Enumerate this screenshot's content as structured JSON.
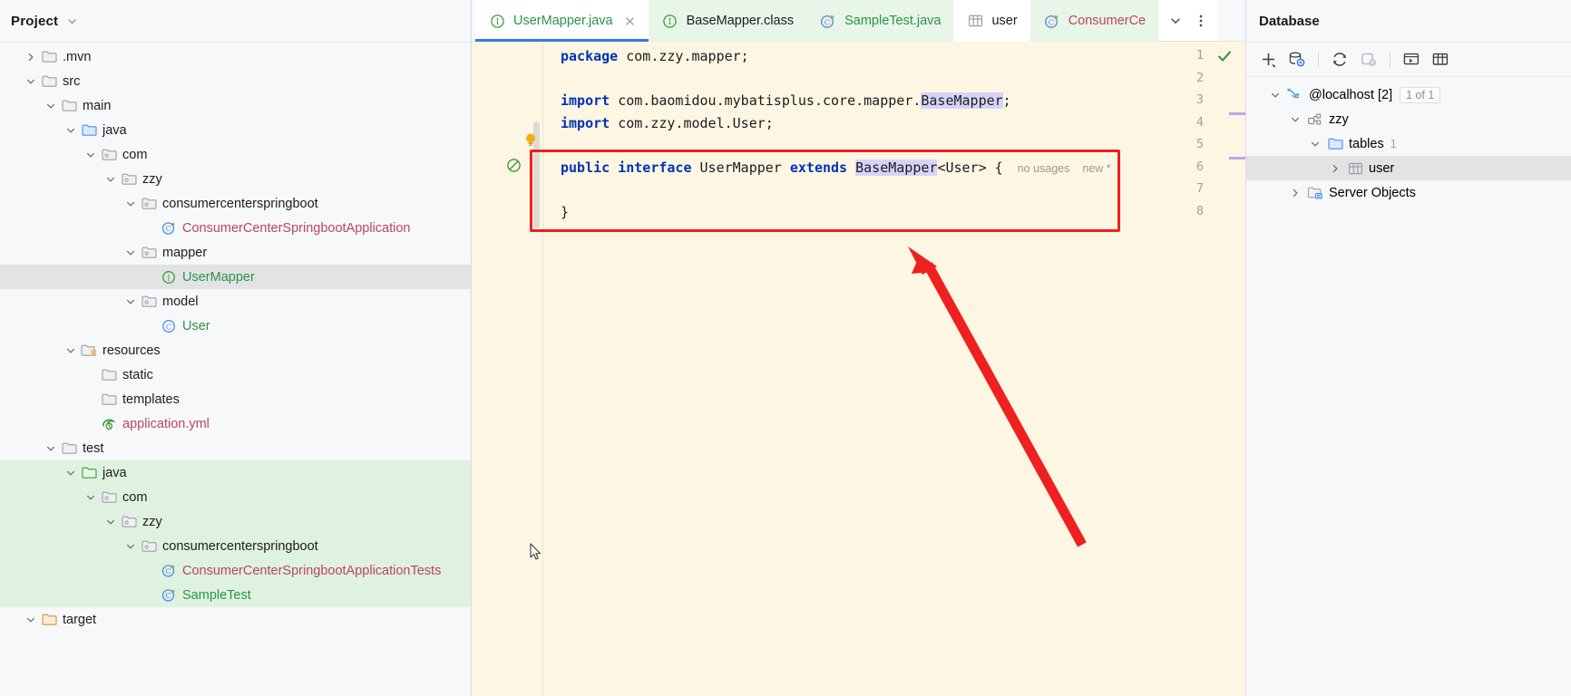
{
  "project": {
    "title": "Project",
    "tree": [
      {
        "label": ".mvn",
        "indent": 1,
        "arrow": "collapsed",
        "icon": "folder-plain",
        "color": "#1d1d1d",
        "band": "none"
      },
      {
        "label": "src",
        "indent": 1,
        "arrow": "expanded",
        "icon": "folder-plain",
        "color": "#1d1d1d",
        "band": "none"
      },
      {
        "label": "main",
        "indent": 2,
        "arrow": "expanded",
        "icon": "folder-plain",
        "color": "#1d1d1d",
        "band": "none"
      },
      {
        "label": "java",
        "indent": 3,
        "arrow": "expanded",
        "icon": "folder-source",
        "color": "#1d1d1d",
        "band": "none"
      },
      {
        "label": "com",
        "indent": 4,
        "arrow": "expanded",
        "icon": "folder-package",
        "color": "#1d1d1d",
        "band": "none"
      },
      {
        "label": "zzy",
        "indent": 5,
        "arrow": "expanded",
        "icon": "folder-package",
        "color": "#1d1d1d",
        "band": "none"
      },
      {
        "label": "consumercenterspringboot",
        "indent": 6,
        "arrow": "expanded",
        "icon": "folder-package",
        "color": "#1d1d1d",
        "band": "none"
      },
      {
        "label": "ConsumerCenterSpringbootApplication",
        "indent": 7,
        "arrow": "none",
        "icon": "spring-class",
        "color": "#bb4466",
        "band": "none"
      },
      {
        "label": "mapper",
        "indent": 6,
        "arrow": "expanded",
        "icon": "folder-package",
        "color": "#1d1d1d",
        "band": "none"
      },
      {
        "label": "UserMapper",
        "indent": 7,
        "arrow": "none",
        "icon": "interface",
        "color": "#2b9348",
        "band": "selected"
      },
      {
        "label": "model",
        "indent": 6,
        "arrow": "expanded",
        "icon": "folder-package",
        "color": "#1d1d1d",
        "band": "none"
      },
      {
        "label": "User",
        "indent": 7,
        "arrow": "none",
        "icon": "class",
        "color": "#2b9348",
        "band": "none"
      },
      {
        "label": "resources",
        "indent": 3,
        "arrow": "expanded",
        "icon": "folder-resource",
        "color": "#1d1d1d",
        "band": "none"
      },
      {
        "label": "static",
        "indent": 4,
        "arrow": "none",
        "icon": "folder-plain",
        "color": "#1d1d1d",
        "band": "none"
      },
      {
        "label": "templates",
        "indent": 4,
        "arrow": "none",
        "icon": "folder-plain",
        "color": "#1d1d1d",
        "band": "none"
      },
      {
        "label": "application.yml",
        "indent": 4,
        "arrow": "none",
        "icon": "spring-yml",
        "color": "#bb4466",
        "band": "none"
      },
      {
        "label": "test",
        "indent": 2,
        "arrow": "expanded",
        "icon": "folder-plain",
        "color": "#1d1d1d",
        "band": "none"
      },
      {
        "label": "java",
        "indent": 3,
        "arrow": "expanded",
        "icon": "folder-test",
        "color": "#1d1d1d",
        "band": "green"
      },
      {
        "label": "com",
        "indent": 4,
        "arrow": "expanded",
        "icon": "folder-package",
        "color": "#1d1d1d",
        "band": "green"
      },
      {
        "label": "zzy",
        "indent": 5,
        "arrow": "expanded",
        "icon": "folder-package",
        "color": "#1d1d1d",
        "band": "green"
      },
      {
        "label": "consumercenterspringboot",
        "indent": 6,
        "arrow": "expanded",
        "icon": "folder-package",
        "color": "#1d1d1d",
        "band": "green"
      },
      {
        "label": "ConsumerCenterSpringbootApplicationTests",
        "indent": 7,
        "arrow": "none",
        "icon": "test-class",
        "color": "#bb4466",
        "band": "green"
      },
      {
        "label": "SampleTest",
        "indent": 7,
        "arrow": "none",
        "icon": "test-class",
        "color": "#2b9348",
        "band": "green"
      },
      {
        "label": "target",
        "indent": 1,
        "arrow": "expanded",
        "icon": "folder-target",
        "color": "#1d1d1d",
        "band": "none"
      }
    ]
  },
  "editor": {
    "tabs": [
      {
        "label": "UserMapper.java",
        "icon": "interface-icon",
        "state": "active",
        "color": "#2b9348",
        "closable": true
      },
      {
        "label": "BaseMapper.class",
        "icon": "interface-icon",
        "state": "green",
        "color": "#1d1d1d",
        "closable": false
      },
      {
        "label": "SampleTest.java",
        "icon": "test-class-icon",
        "state": "green",
        "color": "#2b9348",
        "closable": false
      },
      {
        "label": "user",
        "icon": "table-icon",
        "state": "plain",
        "color": "#1d1d1d",
        "closable": false
      },
      {
        "label": "ConsumerCe",
        "icon": "test-class-icon",
        "state": "green",
        "color": "#bb4466",
        "closable": false
      }
    ],
    "tab_controls": [
      {
        "name": "tab-list-dropdown",
        "glyph": "chevron-down"
      },
      {
        "name": "tab-more-options",
        "glyph": "kebab"
      }
    ],
    "line_numbers": [
      "1",
      "2",
      "3",
      "4",
      "5",
      "6",
      "7",
      "8"
    ],
    "lines": [
      {
        "n": 1,
        "segments": [
          {
            "t": "package",
            "c": "kw"
          },
          {
            "t": " com.zzy.mapper;",
            "c": "plain"
          }
        ]
      },
      {
        "n": 2,
        "segments": []
      },
      {
        "n": 3,
        "segments": [
          {
            "t": "import",
            "c": "kw"
          },
          {
            "t": " com.baomidou.mybatisplus.core.mapper.",
            "c": "plain"
          },
          {
            "t": "BaseMapper",
            "c": "hl"
          },
          {
            "t": ";",
            "c": "plain"
          }
        ]
      },
      {
        "n": 4,
        "segments": [
          {
            "t": "import",
            "c": "kw"
          },
          {
            "t": " com.zzy.model.User;",
            "c": "plain"
          }
        ]
      },
      {
        "n": 5,
        "segments": []
      },
      {
        "n": 6,
        "segments": [
          {
            "t": "public",
            "c": "kw"
          },
          {
            "t": " ",
            "c": "plain"
          },
          {
            "t": "interface",
            "c": "kw"
          },
          {
            "t": " UserMapper ",
            "c": "plain"
          },
          {
            "t": "extends",
            "c": "kw"
          },
          {
            "t": " ",
            "c": "plain"
          },
          {
            "t": "BaseMapper",
            "c": "hl"
          },
          {
            "t": "<User> {",
            "c": "plain"
          }
        ]
      },
      {
        "n": 7,
        "segments": []
      },
      {
        "n": 8,
        "segments": [
          {
            "t": "}",
            "c": "plain"
          }
        ]
      }
    ],
    "inlay_hints": [
      "no usages",
      "new *"
    ],
    "gutter_icons": [
      {
        "name": "intention-bulb-icon",
        "glyph": "bulb",
        "line": 5
      },
      {
        "name": "not-implemented-icon",
        "glyph": "no-entry",
        "line": 6
      }
    ],
    "inspection_status": "ok-check",
    "annotation": {
      "type": "red-box-and-arrow",
      "color": "#ef2020"
    }
  },
  "database": {
    "title": "Database",
    "toolbar": [
      {
        "name": "add-datasource-button",
        "glyph": "plus"
      },
      {
        "name": "datasource-properties-button",
        "glyph": "db-gear"
      },
      {
        "name": "refresh-button",
        "glyph": "refresh"
      },
      {
        "name": "sync-toggle-button",
        "glyph": "sync-off"
      },
      {
        "name": "open-console-button",
        "glyph": "console"
      },
      {
        "name": "open-table-button",
        "glyph": "table"
      }
    ],
    "tree": [
      {
        "label": "@localhost [2]",
        "indent": 1,
        "arrow": "expanded",
        "icon": "mysql-dolphin-icon",
        "badge": "1 of 1",
        "count": "",
        "selected": false
      },
      {
        "label": "zzy",
        "indent": 2,
        "arrow": "expanded",
        "icon": "schema-icon",
        "badge": "",
        "count": "",
        "selected": false
      },
      {
        "label": "tables",
        "indent": 3,
        "arrow": "expanded",
        "icon": "folder-blue-icon",
        "badge": "",
        "count": "1",
        "selected": false
      },
      {
        "label": "user",
        "indent": 4,
        "arrow": "collapsed",
        "icon": "table-icon",
        "badge": "",
        "count": "",
        "selected": true
      },
      {
        "label": "Server Objects",
        "indent": 2,
        "arrow": "collapsed",
        "icon": "server-objects-icon",
        "badge": "",
        "count": "",
        "selected": false
      }
    ]
  }
}
